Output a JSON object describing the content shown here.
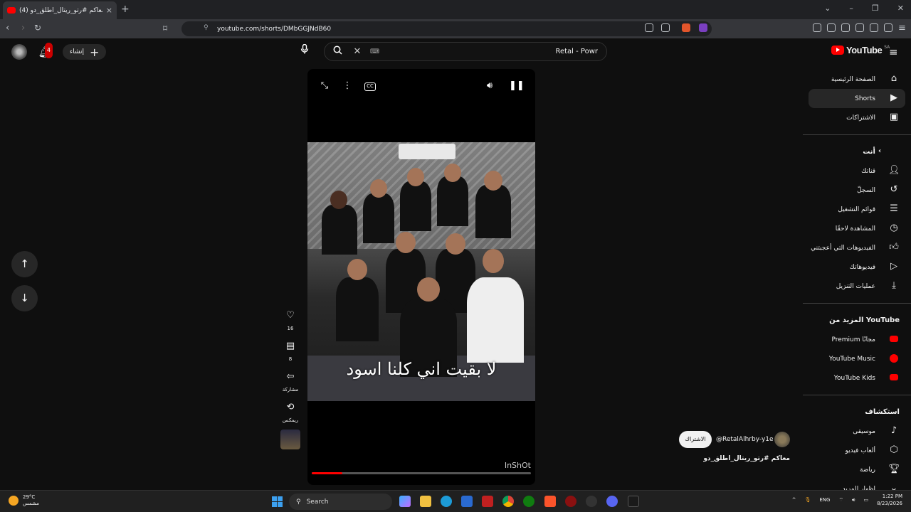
{
  "browser": {
    "tab_title": "(4) معاكم #رتو_ريتال_اطلق_دو",
    "tab_badge": "4",
    "url": "youtube.com/shorts/DMbGGJNdB60"
  },
  "header": {
    "create_label": "إنشاء",
    "notification_count": "4",
    "search_query": "Retal - Powr",
    "logo_text": "YouTube",
    "logo_country": "SA"
  },
  "sidebar": {
    "top_items": [
      {
        "label": "الصفحة الرئيسية",
        "icon": "home-icon"
      },
      {
        "label": "Shorts",
        "icon": "shorts-icon"
      },
      {
        "label": "الاشتراكات",
        "icon": "subscriptions-icon"
      }
    ],
    "you_heading": "أنت",
    "you_items": [
      {
        "label": "قناتك",
        "icon": "channel-icon"
      },
      {
        "label": "السجلّ",
        "icon": "history-icon"
      },
      {
        "label": "قوائم التشغيل",
        "icon": "playlists-icon"
      },
      {
        "label": "المشاهدة لاحقًا",
        "icon": "watch-later-icon"
      },
      {
        "label": "الفيديوهات التي أعجبتني",
        "icon": "liked-icon"
      },
      {
        "label": "فيديوهاتك",
        "icon": "your-videos-icon"
      },
      {
        "label": "عمليات التنزيل",
        "icon": "downloads-icon"
      }
    ],
    "more_heading": "المزيد من YouTube",
    "more_items": [
      {
        "label": "Premium مجانًا",
        "icon": "premium-icon"
      },
      {
        "label": "YouTube Music",
        "icon": "music-icon"
      },
      {
        "label": "YouTube Kids",
        "icon": "kids-icon"
      }
    ],
    "explore_heading": "استكشاف",
    "explore_items": [
      {
        "label": "موسيقى",
        "icon": "music-note-icon"
      },
      {
        "label": "ألعاب فيديو",
        "icon": "gaming-icon"
      },
      {
        "label": "رياضة",
        "icon": "trophy-icon"
      },
      {
        "label": "إظهار المزيد",
        "icon": "chevron-down-icon"
      }
    ]
  },
  "short": {
    "caption": "لا بقيت اني كلنا اسود",
    "watermark": "InShOt",
    "progress": 0.14,
    "likes": "16",
    "comments": "8",
    "share_label": "مشاركة",
    "remix_label": "ريمكس",
    "subscribe_label": "الاشتراك",
    "channel_handle": "@RetalAlhrby-y1e",
    "video_title": "معاكم #رتو_ريتال_اطلق_دو"
  },
  "taskbar": {
    "temperature": "29°C",
    "weather_desc": "مشمس",
    "search_placeholder": "Search",
    "language": "ENG",
    "time": "1:22 PM",
    "date": "8/23/2026"
  },
  "colors": {
    "yt_red": "#ff0000",
    "background": "#0f0f0f",
    "chip": "#272727"
  }
}
